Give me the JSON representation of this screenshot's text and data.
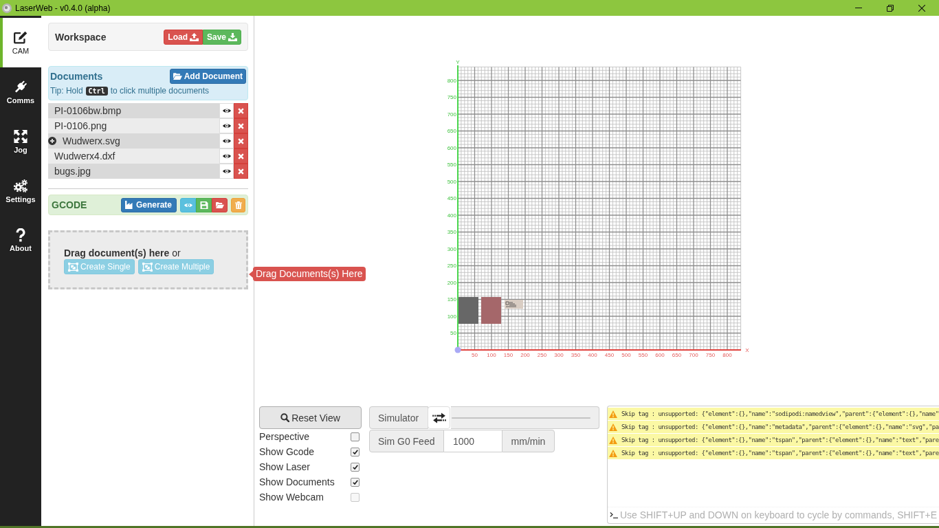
{
  "window": {
    "title": "LaserWeb - v0.4.0 (alpha)"
  },
  "nav": [
    {
      "label": "CAM",
      "selected": true
    },
    {
      "label": "Comms",
      "selected": false
    },
    {
      "label": "Jog",
      "selected": false
    },
    {
      "label": "Settings",
      "selected": false
    },
    {
      "label": "About",
      "selected": false
    }
  ],
  "workspace": {
    "title": "Workspace",
    "load_button": "Load",
    "save_button": "Save"
  },
  "documents": {
    "title": "Documents",
    "add_button": "Add Document",
    "tip": {
      "before": "Tip: Hold",
      "key": "Ctrl",
      "after": "to click multiple documents"
    },
    "items": [
      {
        "name": "PI-0106bw.bmp",
        "kind": "file"
      },
      {
        "name": "PI-0106.png",
        "kind": "file"
      },
      {
        "name": "Wudwerx.svg",
        "kind": "group"
      },
      {
        "name": "Wudwerx4.dxf",
        "kind": "file"
      },
      {
        "name": "bugs.jpg",
        "kind": "file"
      }
    ]
  },
  "gcode": {
    "title": "GCODE",
    "generate_button": "Generate"
  },
  "dropzone": {
    "text": "**Drag document(s) here** or",
    "buttons": [
      "Create Single",
      "Create Multiple"
    ],
    "tooltip": "Drag Documents(s) Here"
  },
  "viewport": {
    "y_axis_title": "Y",
    "y_ticks": [
      "800",
      "750",
      "700",
      "650",
      "600",
      "550",
      "500",
      "450",
      "400",
      "350",
      "300",
      "250",
      "200",
      "150",
      "100",
      "50"
    ],
    "x_ticks": [
      "50",
      "100",
      "150",
      "200",
      "250",
      "300",
      "350",
      "400",
      "450",
      "500",
      "550",
      "600",
      "650",
      "700",
      "750",
      "800"
    ],
    "x_axis_title": "X"
  },
  "view_controls": {
    "reset_button": "Reset View",
    "options": [
      {
        "label": "Perspective",
        "checked": false,
        "disabled": false
      },
      {
        "label": "Show Gcode",
        "checked": true,
        "disabled": false
      },
      {
        "label": "Show Laser",
        "checked": true,
        "disabled": false
      },
      {
        "label": "Show Documents",
        "checked": true,
        "disabled": false
      },
      {
        "label": "Show Webcam",
        "checked": false,
        "disabled": true
      }
    ]
  },
  "simulator": {
    "label": "Simulator",
    "level": 0,
    "feed_label": "Sim G0 Feed",
    "feed_value": "1000",
    "feed_unit": "mm/min"
  },
  "console": {
    "lines": [
      {
        "kind": "warning",
        "text": "Skip tag : unsupported: {\"element\":{},\"name\":\"sodipodi:namedview\",\"parent\":{\"element\":{},\"name\""
      },
      {
        "kind": "warning",
        "text": "Skip tag : unsupported: {\"element\":{},\"name\":\"metadata\",\"parent\":{\"element\":{},\"name\":\"svg\",\"pa"
      },
      {
        "kind": "warning",
        "text": "Skip tag : unsupported: {\"element\":{},\"name\":\"tspan\",\"parent\":{\"element\":{},\"name\":\"text\",\"pare"
      },
      {
        "kind": "warning",
        "text": "Skip tag : unsupported: {\"element\":{},\"name\":\"tspan\",\"parent\":{\"element\":{},\"name\":\"text\",\"pare"
      }
    ],
    "placeholder": "Use SHIFT+UP and DOWN on keyboard to cycle by commands, SHIFT+E"
  }
}
